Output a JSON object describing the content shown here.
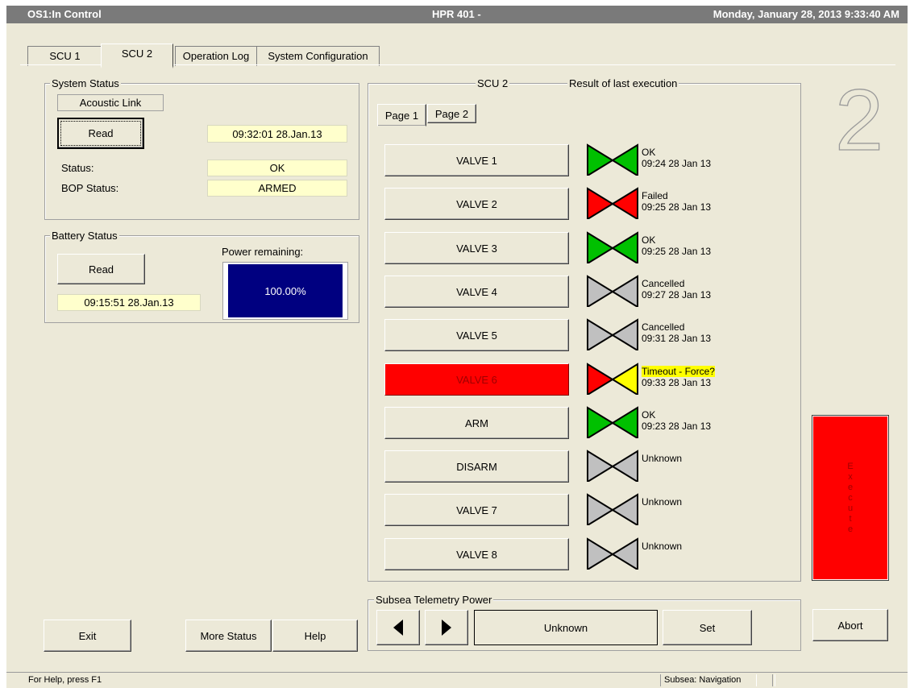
{
  "titlebar": {
    "left": "OS1:In Control",
    "center": "HPR 401 -",
    "right": "Monday, January 28, 2013 9:33:40 AM"
  },
  "tabs": [
    {
      "label": "SCU 1",
      "active": false
    },
    {
      "label": "SCU 2",
      "active": true
    },
    {
      "label": "Operation Log",
      "active": false
    },
    {
      "label": "System Configuration",
      "active": false
    }
  ],
  "system_status": {
    "title": "System Status",
    "acoustic_link": "Acoustic Link",
    "read_label": "Read",
    "timestamp": "09:32:01 28.Jan.13",
    "status_label": "Status:",
    "status_value": "OK",
    "bop_label": "BOP Status:",
    "bop_value": "ARMED"
  },
  "battery_status": {
    "title": "Battery Status",
    "read_label": "Read",
    "timestamp": "09:15:51 28.Jan.13",
    "power_label": "Power remaining:",
    "power_value": "100.00%",
    "power_fraction": 1.0
  },
  "scu_panel": {
    "title": "SCU 2",
    "result_title": "Result of last execution",
    "page_tabs": [
      "Page 1",
      "Page 2"
    ],
    "big_number": "2",
    "rows": [
      {
        "label": "VALVE 1",
        "state": "green",
        "result": "OK",
        "time": "09:24 28 Jan 13",
        "highlight": false
      },
      {
        "label": "VALVE 2",
        "state": "red",
        "result": "Failed",
        "time": "09:25 28 Jan 13",
        "highlight": false
      },
      {
        "label": "VALVE 3",
        "state": "green",
        "result": "OK",
        "time": "09:25 28 Jan 13",
        "highlight": false
      },
      {
        "label": "VALVE 4",
        "state": "grey",
        "result": "Cancelled",
        "time": "09:27 28 Jan 13",
        "highlight": false
      },
      {
        "label": "VALVE 5",
        "state": "grey",
        "result": "Cancelled",
        "time": "09:31 28 Jan 13",
        "highlight": false
      },
      {
        "label": "VALVE 6",
        "state": "red-yellow",
        "result": "Timeout - Force?",
        "time": "09:33 28 Jan 13",
        "highlight": true
      },
      {
        "label": "ARM",
        "state": "green",
        "result": "OK",
        "time": "09:23 28 Jan 13",
        "highlight": false
      },
      {
        "label": "DISARM",
        "state": "grey",
        "result": "Unknown",
        "time": "",
        "highlight": false
      },
      {
        "label": "VALVE 7",
        "state": "grey",
        "result": "Unknown",
        "time": "",
        "highlight": false
      },
      {
        "label": "VALVE 8",
        "state": "grey",
        "result": "Unknown",
        "time": "",
        "highlight": false
      }
    ]
  },
  "telemetry": {
    "title": "Subsea Telemetry Power",
    "value": "Unknown",
    "set_label": "Set"
  },
  "execute": {
    "letters": [
      "E",
      "x",
      "e",
      "c",
      "u",
      "t",
      "e"
    ]
  },
  "buttons": {
    "exit": "Exit",
    "more_status": "More Status",
    "help": "Help",
    "abort": "Abort"
  },
  "statusbar": {
    "help": "For Help, press F1",
    "mode": "Subsea: Navigation"
  },
  "colors": {
    "green": "#00c000",
    "red": "#ff0000",
    "grey": "#c0c0c0",
    "yellow": "#ffff00",
    "navy": "#000080"
  }
}
